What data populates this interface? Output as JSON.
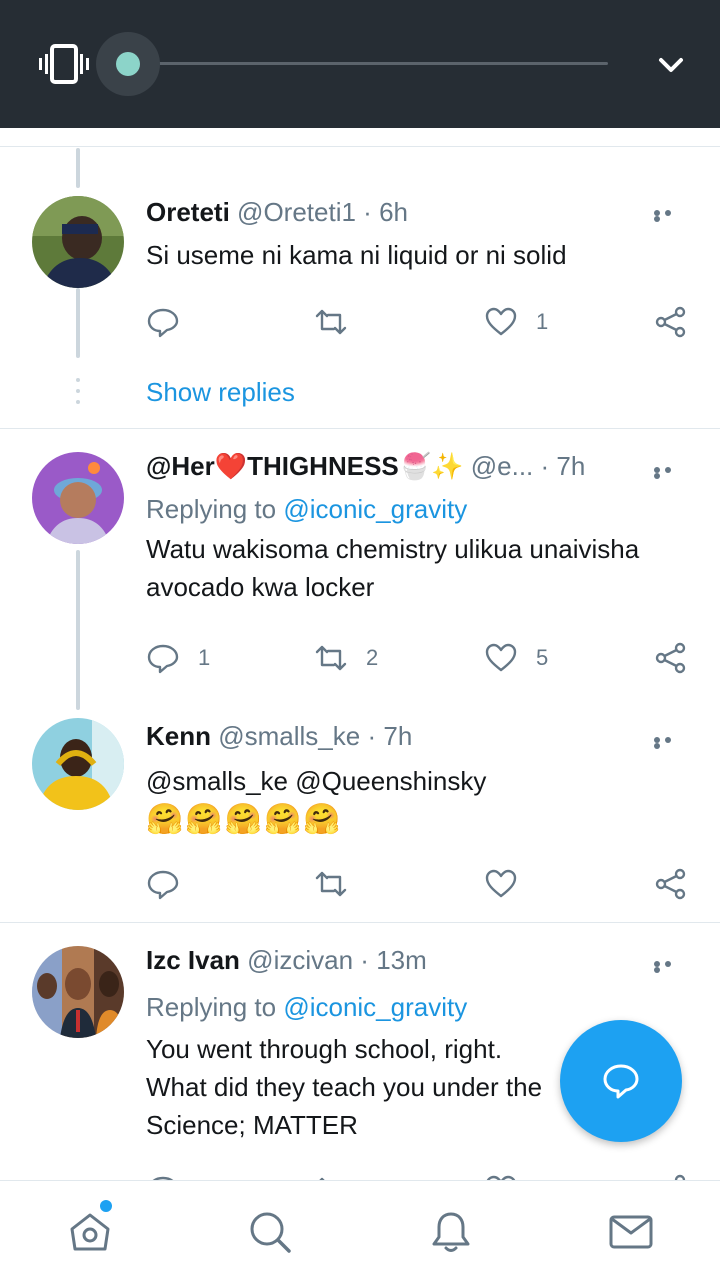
{
  "audio_bar": {
    "progress": 0.0
  },
  "tweets": [
    {
      "name": "Oreteti",
      "handle": "@Oreteti1",
      "time": "6h",
      "text": "Si useme ni kama ni liquid or ni solid",
      "replies": "",
      "retweets": "",
      "likes": "1",
      "show_replies": "Show replies"
    },
    {
      "name": "@Her❤️THIGHNESS🍧✨",
      "handle": "@e...",
      "time": "7h",
      "replying_label": "Replying to",
      "replying_to": "@iconic_gravity",
      "text": "Watu wakisoma chemistry ulikua unaivisha avocado kwa locker",
      "replies": "1",
      "retweets": "2",
      "likes": "5"
    },
    {
      "name": "Kenn",
      "handle": "@smalls_ke",
      "time": "7h",
      "mentions": "@smalls_ke @Queenshinsky",
      "emojis": "🤗🤗🤗🤗🤗",
      "replies": "",
      "retweets": "",
      "likes": ""
    },
    {
      "name": "Izc Ivan",
      "handle": "@izcivan",
      "time": "13m",
      "replying_label": "Replying to",
      "replying_to": "@iconic_gravity",
      "text_line1": "You went through school, right.",
      "text_line2": "What did they teach you under the",
      "text_line3": "Science; MATTER"
    }
  ],
  "colors": {
    "accent": "#1da1f2",
    "link": "#1b95e0",
    "muted": "#657786",
    "topbar": "#262d34"
  },
  "icons": [
    "vibrate-icon",
    "chevron-down-icon",
    "reply-icon",
    "retweet-icon",
    "like-icon",
    "share-icon",
    "more-icon",
    "compose-reply-icon",
    "home-icon",
    "search-icon",
    "notifications-icon",
    "messages-icon"
  ]
}
